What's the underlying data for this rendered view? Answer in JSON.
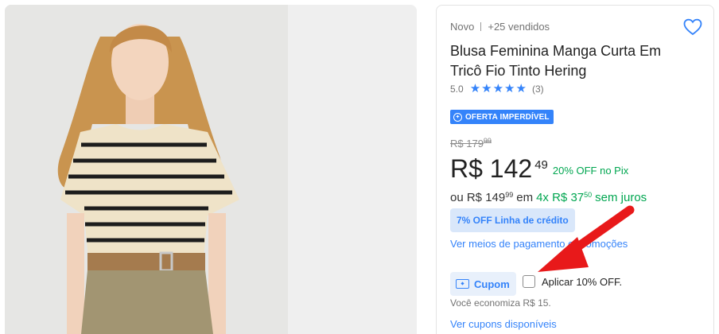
{
  "product": {
    "condition": "Novo",
    "sold": "+25 vendidos",
    "title": "Blusa Feminina Manga Curta Em Tricô Fio Tinto Hering",
    "rating_value": "5.0",
    "rating_stars": 5,
    "rating_count": "(3)",
    "badge": "OFERTA IMPERDÍVEL",
    "old_price_main": "R$ 179",
    "old_price_cents": "99",
    "price_main": "R$ 142",
    "price_cents": "49",
    "pix_discount": "20% OFF no Pix",
    "installment_prefix": "ou R$ 149",
    "installment_prefix_cents": "99",
    "installment_mid": "em",
    "installment_text": "4x R$ 37",
    "installment_cents": "50",
    "installment_suffix": "sem juros",
    "credit_offer": "7% OFF Linha de crédito",
    "payment_link": "Ver meios de pagamento e promoções",
    "coupon_label": "Cupom",
    "coupon_checkbox_label": "Aplicar 10% OFF.",
    "coupon_checked": false,
    "savings_text": "Você economiza R$ 15.",
    "coupons_link": "Ver cupons disponíveis"
  },
  "icons": {
    "favorite": "heart-icon",
    "badge": "offer-icon",
    "coupon": "ticket-icon",
    "annotation": "red-arrow"
  },
  "colors": {
    "accent": "#3483fa",
    "success": "#00a650",
    "annotation": "#e8191a"
  }
}
